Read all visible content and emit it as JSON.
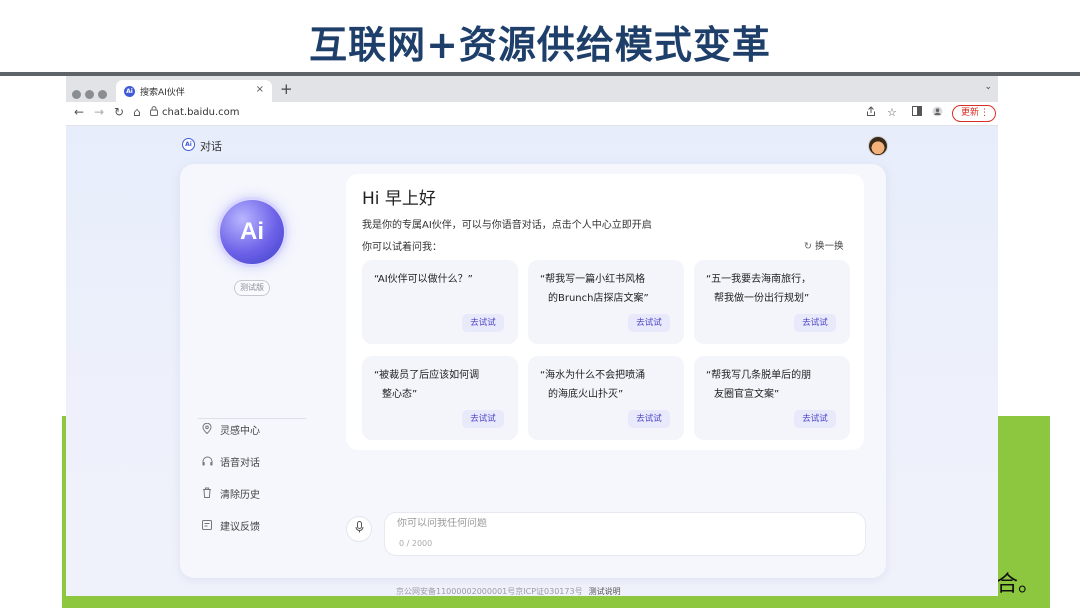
{
  "slide": {
    "title": "互联网+资源供给模式变革",
    "trailing_text": "合。"
  },
  "browser": {
    "tab": {
      "favicon": "Ai",
      "title": "搜索AI伙伴",
      "close": "×",
      "new_tab": "+"
    },
    "tab_menu": "⌄",
    "nav": {
      "back": "←",
      "forward": "→",
      "reload": "↻",
      "home": "⌂"
    },
    "url": "chat.baidu.com",
    "update_label": "更新",
    "more": "⋮"
  },
  "page": {
    "logo_text": "Ai",
    "label": "对话",
    "badge_text": "Ai",
    "test_tag": "测试版",
    "sidebar": {
      "items": [
        {
          "label": "灵感中心",
          "icon": "pin-icon"
        },
        {
          "label": "语音对话",
          "icon": "headphones-icon"
        },
        {
          "label": "清除历史",
          "icon": "trash-icon"
        },
        {
          "label": "建议反馈",
          "icon": "feedback-icon"
        }
      ]
    },
    "greeting": "Hi 早上好",
    "intro": "我是你的专属AI伙伴，可以与你语音对话，点击个人中心立即开启",
    "try_ask": "你可以试着问我：",
    "refresh_label": "换一换",
    "suggestions": [
      {
        "line1": "“AI伙伴可以做什么？”",
        "line2": "",
        "button": "去试试"
      },
      {
        "line1": "“帮我写一篇小红书风格",
        "line2": "的Brunch店探店文案”",
        "button": "去试试"
      },
      {
        "line1": "“五一我要去海南旅行，",
        "line2": "帮我做一份出行规划”",
        "button": "去试试"
      },
      {
        "line1": "“被裁员了后应该如何调",
        "line2": "整心态”",
        "button": "去试试"
      },
      {
        "line1": "“海水为什么不会把喷涌",
        "line2": "的海底火山扑灭”",
        "button": "去试试"
      },
      {
        "line1": "“帮我写几条脱单后的朋",
        "line2": "友圈官宣文案”",
        "button": "去试试"
      }
    ],
    "input": {
      "placeholder": "你可以问我任何问题",
      "counter": "0 / 2000"
    },
    "footer": {
      "record": "京公网安备11000002000001号京ICP证030173号",
      "test_note": "测试说明"
    }
  }
}
